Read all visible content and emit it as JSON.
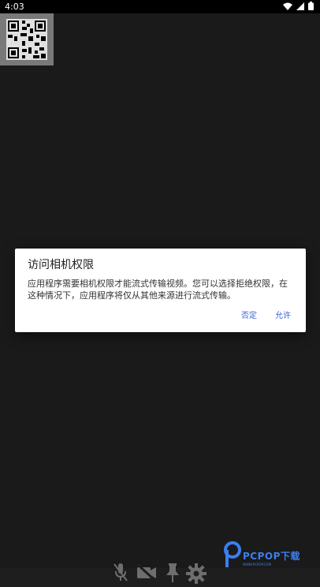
{
  "status_bar": {
    "time": "4:03",
    "icons": [
      "wifi-icon",
      "signal-icon",
      "battery-icon"
    ]
  },
  "dialog": {
    "title": "访问相机权限",
    "message": "应用程序需要相机权限才能流式传输视频。您可以选择拒绝权限，在这种情况下，应用程序将仅从其他来源进行流式传输。",
    "deny_label": "否定",
    "allow_label": "允许",
    "accent_color": "#3b63d6"
  },
  "toolbar": {
    "icons": [
      "mic-off-icon",
      "video-off-icon",
      "pin-icon",
      "gear-icon"
    ]
  },
  "watermark": {
    "text": "PCPOP下载",
    "subtext": "WWW.PCPOP.COM"
  }
}
